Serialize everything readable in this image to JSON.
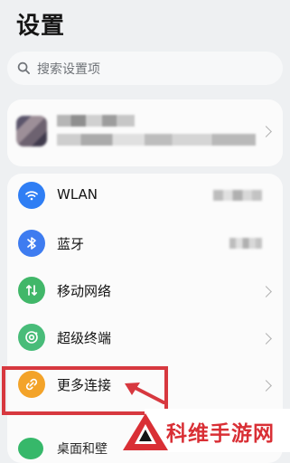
{
  "header": {
    "title": "设置"
  },
  "search": {
    "placeholder": "搜索设置项"
  },
  "settings": {
    "items": [
      {
        "label": "WLAN",
        "icon": "wifi-icon",
        "color": "#2f7ef4"
      },
      {
        "label": "蓝牙",
        "icon": "bluetooth-icon",
        "color": "#3e7cf0"
      },
      {
        "label": "移动网络",
        "icon": "mobile-data-icon",
        "color": "#41b769"
      },
      {
        "label": "超级终端",
        "icon": "super-device-icon",
        "color": "#48bc79"
      },
      {
        "label": "更多连接",
        "icon": "link-icon",
        "color": "#f3a329"
      },
      {
        "label": "桌面和壁",
        "icon": "desktop-icon",
        "color": "#36b86a"
      }
    ]
  },
  "watermark": {
    "text": "科维手游网"
  },
  "colors": {
    "background": "#eef0f2",
    "card": "#fbfbfb",
    "highlight": "#d7383f",
    "watermark": "#d92f35"
  }
}
